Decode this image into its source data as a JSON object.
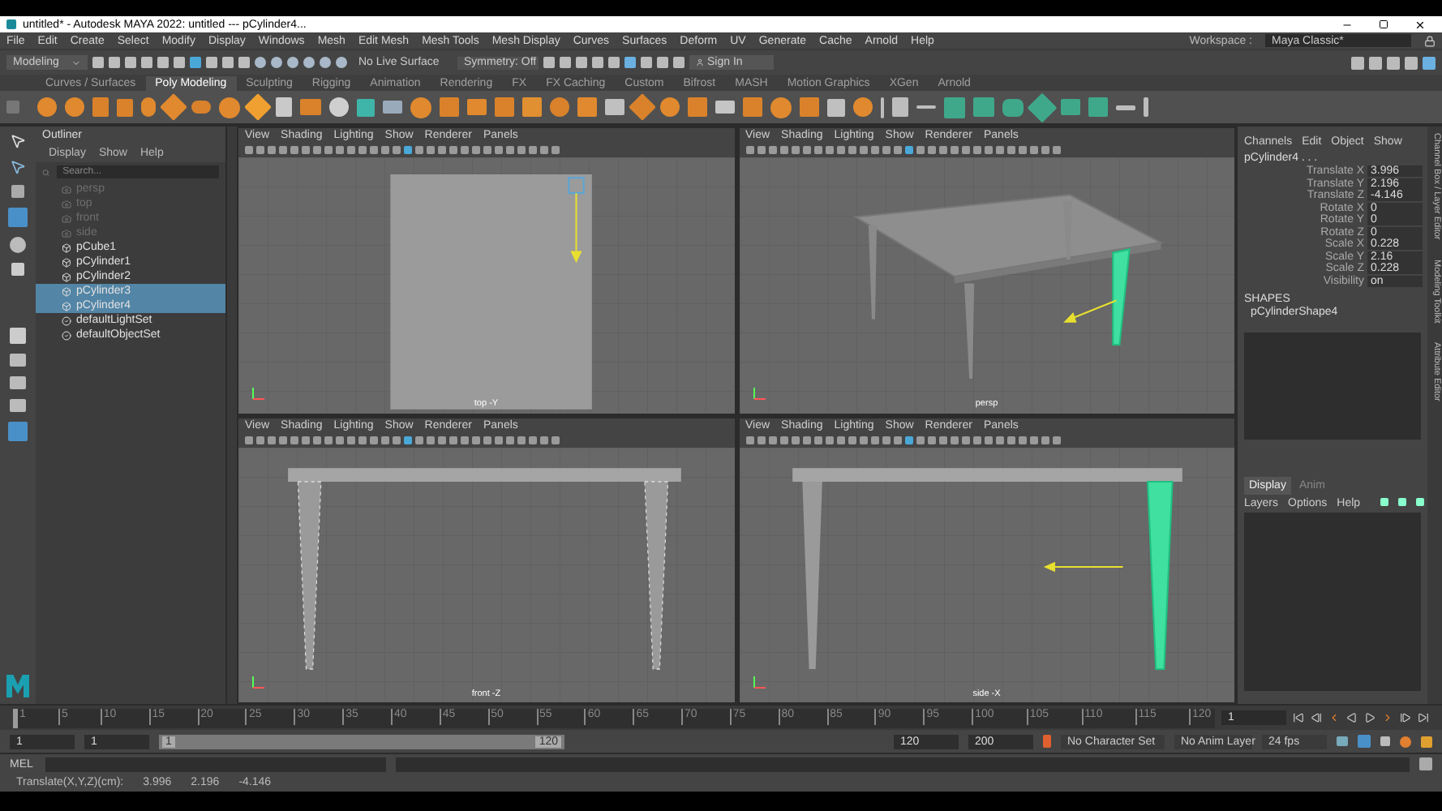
{
  "window": {
    "title": "untitled* - Autodesk MAYA 2022: untitled   ---   pCylinder4..."
  },
  "menu_bar": [
    "File",
    "Edit",
    "Create",
    "Select",
    "Modify",
    "Display",
    "Windows",
    "Mesh",
    "Edit Mesh",
    "Mesh Tools",
    "Mesh Display",
    "Curves",
    "Surfaces",
    "Deform",
    "UV",
    "Generate",
    "Cache",
    "Arnold",
    "Help"
  ],
  "workspace": {
    "label": "Workspace :",
    "value": "Maya Classic*"
  },
  "status_line": {
    "menu_set": "Modeling",
    "live_surface": "No Live Surface",
    "symmetry": "Symmetry: Off",
    "sign_in": "Sign In"
  },
  "shelf_tabs": [
    {
      "label": "Curves / Surfaces",
      "selected": false
    },
    {
      "label": "Poly Modeling",
      "selected": true
    },
    {
      "label": "Sculpting",
      "selected": false
    },
    {
      "label": "Rigging",
      "selected": false
    },
    {
      "label": "Animation",
      "selected": false
    },
    {
      "label": "Rendering",
      "selected": false
    },
    {
      "label": "FX",
      "selected": false
    },
    {
      "label": "FX Caching",
      "selected": false
    },
    {
      "label": "Custom",
      "selected": false
    },
    {
      "label": "Bifrost",
      "selected": false
    },
    {
      "label": "MASH",
      "selected": false
    },
    {
      "label": "Motion Graphics",
      "selected": false
    },
    {
      "label": "XGen",
      "selected": false
    },
    {
      "label": "Arnold",
      "selected": false
    }
  ],
  "outliner": {
    "title": "Outliner",
    "menus": [
      "Display",
      "Show",
      "Help"
    ],
    "search": {
      "placeholder": "Search..."
    },
    "items": [
      {
        "label": "persp",
        "kind": "camera",
        "dimmed": true,
        "selected": false
      },
      {
        "label": "top",
        "kind": "camera",
        "dimmed": true,
        "selected": false
      },
      {
        "label": "front",
        "kind": "camera",
        "dimmed": true,
        "selected": false
      },
      {
        "label": "side",
        "kind": "camera",
        "dimmed": true,
        "selected": false
      },
      {
        "label": "pCube1",
        "kind": "mesh",
        "dimmed": false,
        "selected": false
      },
      {
        "label": "pCylinder1",
        "kind": "mesh",
        "dimmed": false,
        "selected": false
      },
      {
        "label": "pCylinder2",
        "kind": "mesh",
        "dimmed": false,
        "selected": false
      },
      {
        "label": "pCylinder3",
        "kind": "mesh",
        "dimmed": false,
        "selected": true
      },
      {
        "label": "pCylinder4",
        "kind": "mesh",
        "dimmed": false,
        "selected": true
      },
      {
        "label": "defaultLightSet",
        "kind": "set",
        "dimmed": false,
        "selected": false
      },
      {
        "label": "defaultObjectSet",
        "kind": "set",
        "dimmed": false,
        "selected": false
      }
    ]
  },
  "viewports": [
    {
      "kind": "top",
      "menus": [
        "View",
        "Shading",
        "Lighting",
        "Show",
        "Renderer",
        "Panels"
      ],
      "label": "top -Y"
    },
    {
      "kind": "persp",
      "menus": [
        "View",
        "Shading",
        "Lighting",
        "Show",
        "Renderer",
        "Panels"
      ],
      "label": "persp"
    },
    {
      "kind": "front",
      "menus": [
        "View",
        "Shading",
        "Lighting",
        "Show",
        "Renderer",
        "Panels"
      ],
      "label": "front -Z"
    },
    {
      "kind": "side",
      "menus": [
        "View",
        "Shading",
        "Lighting",
        "Show",
        "Renderer",
        "Panels"
      ],
      "label": "side -X"
    }
  ],
  "channel_box": {
    "menus": [
      "Channels",
      "Edit",
      "Object",
      "Show"
    ],
    "object": "pCylinder4 . . .",
    "attributes": [
      {
        "name": "Translate X",
        "value": "3.996"
      },
      {
        "name": "Translate Y",
        "value": "2.196"
      },
      {
        "name": "Translate Z",
        "value": "-4.146"
      },
      {
        "name": "Rotate X",
        "value": "0"
      },
      {
        "name": "Rotate Y",
        "value": "0"
      },
      {
        "name": "Rotate Z",
        "value": "0"
      },
      {
        "name": "Scale X",
        "value": "0.228"
      },
      {
        "name": "Scale Y",
        "value": "2.16"
      },
      {
        "name": "Scale Z",
        "value": "0.228"
      },
      {
        "name": "Visibility",
        "value": "on"
      }
    ],
    "shapes_heading": "SHAPES",
    "shape": "pCylinderShape4"
  },
  "side_tabs": [
    "Channel Box / Layer Editor",
    "Modeling Toolkit",
    "Attribute Editor"
  ],
  "layer_editor": {
    "tabs": [
      {
        "label": "Display",
        "selected": true
      },
      {
        "label": "Anim",
        "selected": false
      }
    ],
    "menus": [
      "Layers",
      "Options",
      "Help"
    ]
  },
  "timeline": {
    "ticks": [
      "1",
      "5",
      "10",
      "15",
      "20",
      "25",
      "30",
      "35",
      "40",
      "45",
      "50",
      "55",
      "60",
      "65",
      "70",
      "75",
      "80",
      "85",
      "90",
      "95",
      "100",
      "105",
      "110",
      "115",
      "120"
    ],
    "current_frame": "1",
    "level": 0
  },
  "range": {
    "level": 1,
    "start": "1",
    "playback_start": "1",
    "slider_start": "1",
    "slider_end": "120",
    "playback_end": "120",
    "end": "200",
    "character_set": "No Character Set",
    "anim_layer": "No Anim Layer",
    "fps": "24 fps"
  },
  "command_line": {
    "label": "MEL"
  },
  "help_line": {
    "text": "Translate(X,Y,Z)(cm):",
    "values": [
      "3.996",
      "2.196",
      "-4.146"
    ]
  }
}
